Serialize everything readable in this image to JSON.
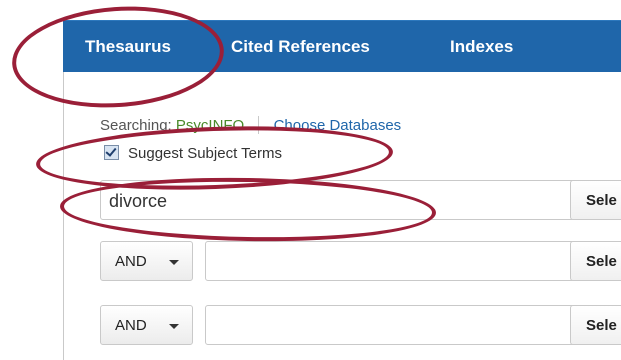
{
  "nav": {
    "tabs": [
      "Thesaurus",
      "Cited References",
      "Indexes"
    ]
  },
  "search_context": {
    "searching_label": "Searching:",
    "database": "PsycINFO",
    "choose_databases": "Choose Databases"
  },
  "suggest_subject_terms": {
    "label": "Suggest Subject Terms",
    "checked": true
  },
  "rows": [
    {
      "value": "divorce",
      "select_label": "Sele"
    },
    {
      "operator": "AND",
      "value": "",
      "select_label": "Sele"
    },
    {
      "operator": "AND",
      "value": "",
      "select_label": "Sele"
    }
  ],
  "colors": {
    "nav_bg": "#1f66aa",
    "annotation": "#9a1f38",
    "link": "#1f66aa",
    "database": "#4a8a2a"
  }
}
